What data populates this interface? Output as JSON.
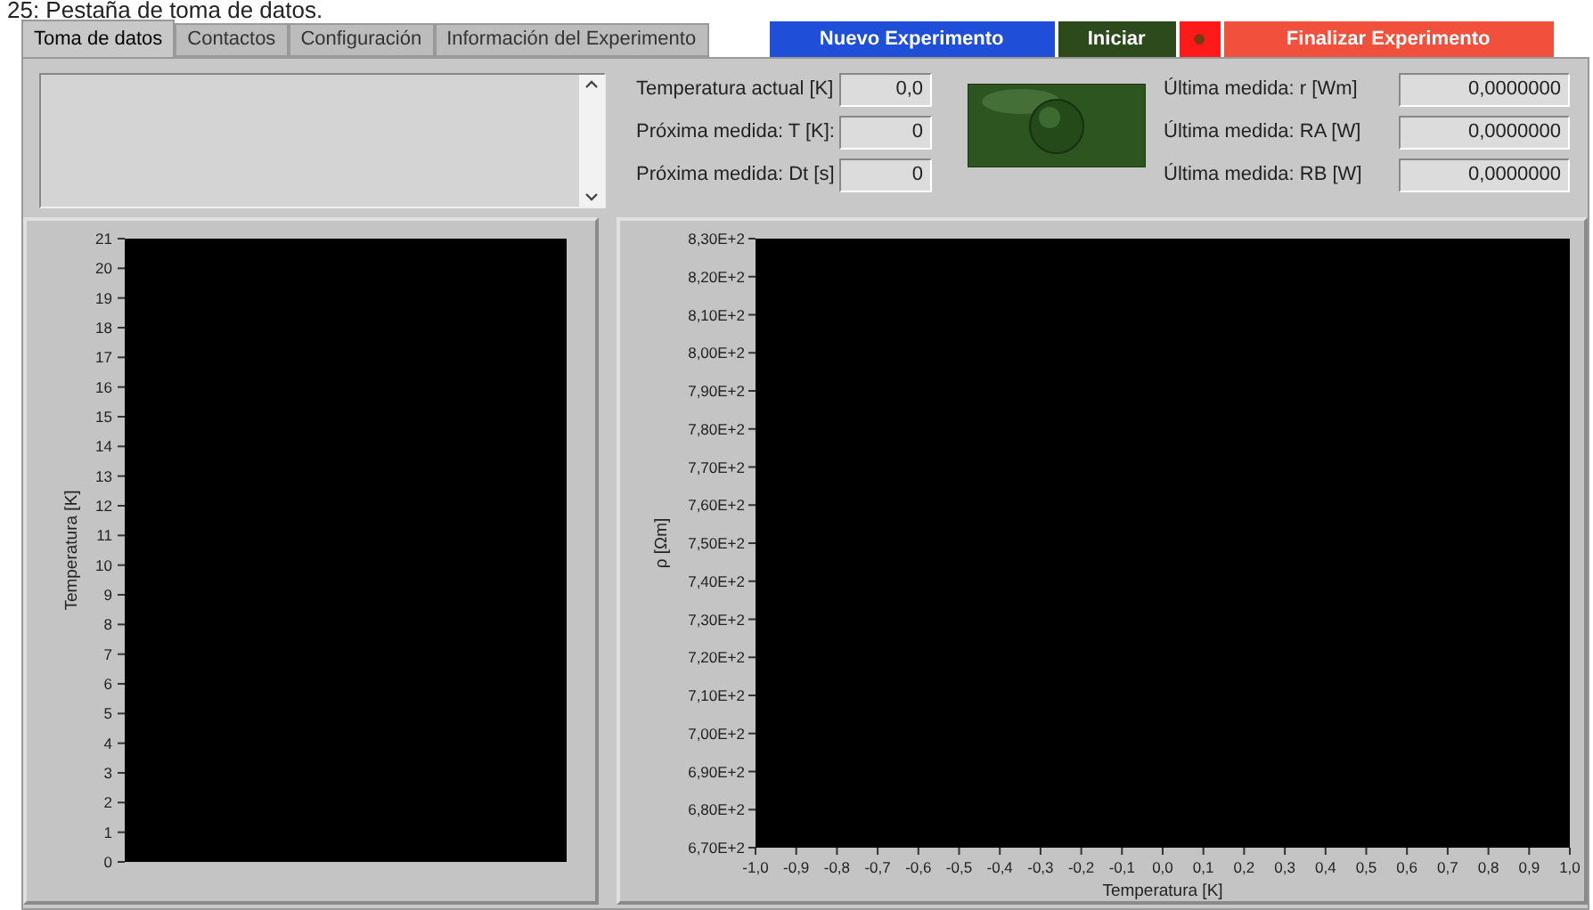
{
  "caption": "25: Pestaña de toma de datos.",
  "tabs": [
    {
      "label": "Toma de datos",
      "selected": true
    },
    {
      "label": "Contactos",
      "selected": false
    },
    {
      "label": "Configuración",
      "selected": false
    },
    {
      "label": "Información del Experimento",
      "selected": false
    }
  ],
  "buttons": [
    {
      "kind": "new",
      "label": "Nuevo Experimento"
    },
    {
      "kind": "start",
      "label": "Iniciar"
    },
    {
      "kind": "led",
      "on": true
    },
    {
      "kind": "stop",
      "label": "Finalizar Experimento"
    }
  ],
  "left_fields": [
    {
      "label": "Temperatura actual [K]",
      "value": "0,0"
    },
    {
      "label": "Próxima medida: T [K]:",
      "value": "0"
    },
    {
      "label": "Próxima medida: Dt [s]",
      "value": "0"
    }
  ],
  "indicator": {
    "on": false
  },
  "right_fields": [
    {
      "label": "Última medida: r [Wm]",
      "value": "0,0000000"
    },
    {
      "label": "Última medida: RA [W]",
      "value": "0,0000000"
    },
    {
      "label": "Última medida: RB [W]",
      "value": "0,0000000"
    }
  ],
  "temperature_graph": {
    "y_axis_title": "Temperatura [K]",
    "y_axis_labels": [
      "21",
      "20",
      "19",
      "18",
      "17",
      "16",
      "15",
      "14",
      "13",
      "12",
      "11",
      "10",
      "9",
      "8",
      "7",
      "6",
      "5",
      "4",
      "3",
      "2",
      "1",
      "0"
    ]
  },
  "resistivity_graph": {
    "y_axis_title": "ρ [Ωm]",
    "y_axis_labels": [
      "8,30E+2",
      "8,20E+2",
      "8,10E+2",
      "8,00E+2",
      "7,90E+2",
      "7,80E+2",
      "7,70E+2",
      "7,60E+2",
      "7,50E+2",
      "7,40E+2",
      "7,30E+2",
      "7,20E+2",
      "7,10E+2",
      "7,00E+2",
      "6,90E+2",
      "6,80E+2",
      "6,70E+2"
    ],
    "x_axis_labels": [
      "-1,0",
      "-0,9",
      "-0,8",
      "-0,7",
      "-0,6",
      "-0,5",
      "-0,4",
      "-0,3",
      "-0,2",
      "-0,1",
      "0,0",
      "0,1",
      "0,2",
      "0,3",
      "0,4",
      "0,5",
      "0,6",
      "0,7",
      "0,8",
      "0,9",
      "1,0"
    ],
    "x_axis_title": "Temperatura [K]"
  }
}
